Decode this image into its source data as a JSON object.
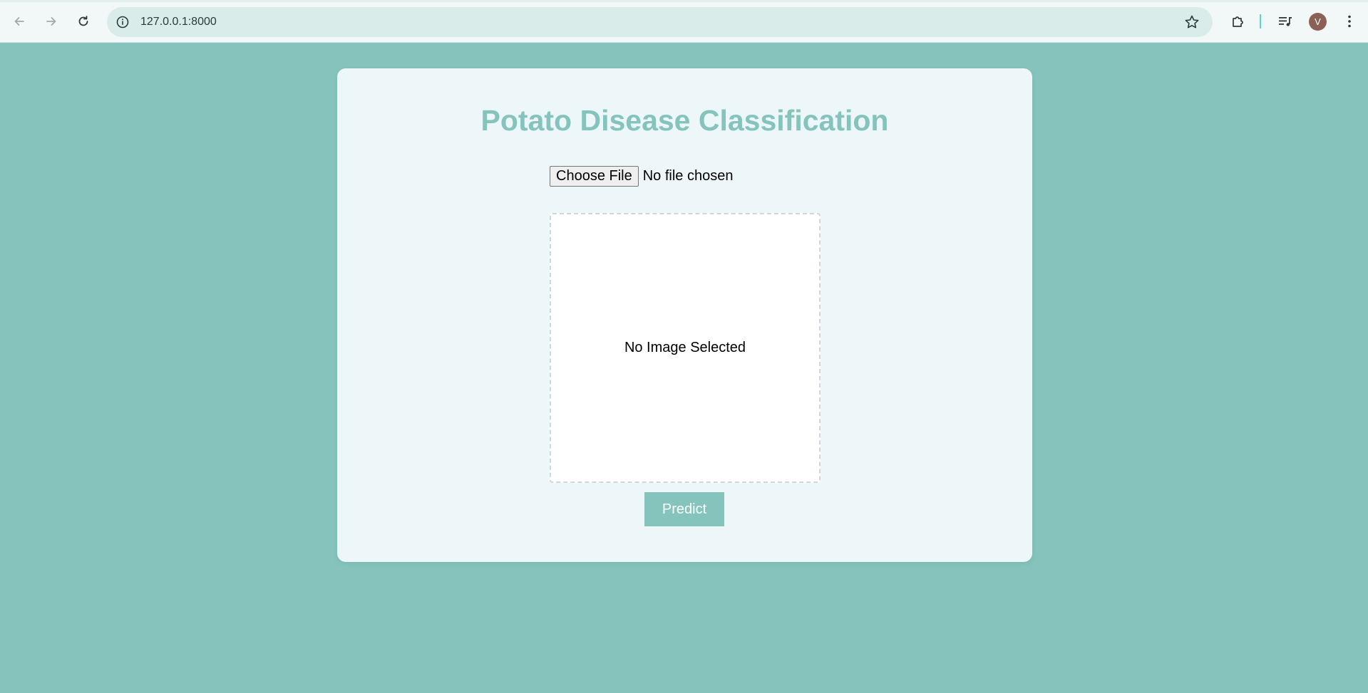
{
  "browser": {
    "url": "127.0.0.1:8000",
    "avatar_letter": "V",
    "icons": {
      "back": "arrow-left-icon",
      "forward": "arrow-right-icon",
      "reload": "reload-icon",
      "site_info": "info-icon",
      "bookmark": "star-icon",
      "extensions": "puzzle-icon",
      "media": "media-queue-icon",
      "menu": "kebab-menu-icon"
    }
  },
  "page": {
    "title": "Potato Disease Classification",
    "file_input": {
      "button_label": "Choose File",
      "status": "No file chosen"
    },
    "preview": {
      "placeholder": "No Image Selected"
    },
    "predict_label": "Predict"
  },
  "colors": {
    "background": "#85c3bc",
    "accent": "#84c4bc",
    "card": "#edf6f8"
  }
}
